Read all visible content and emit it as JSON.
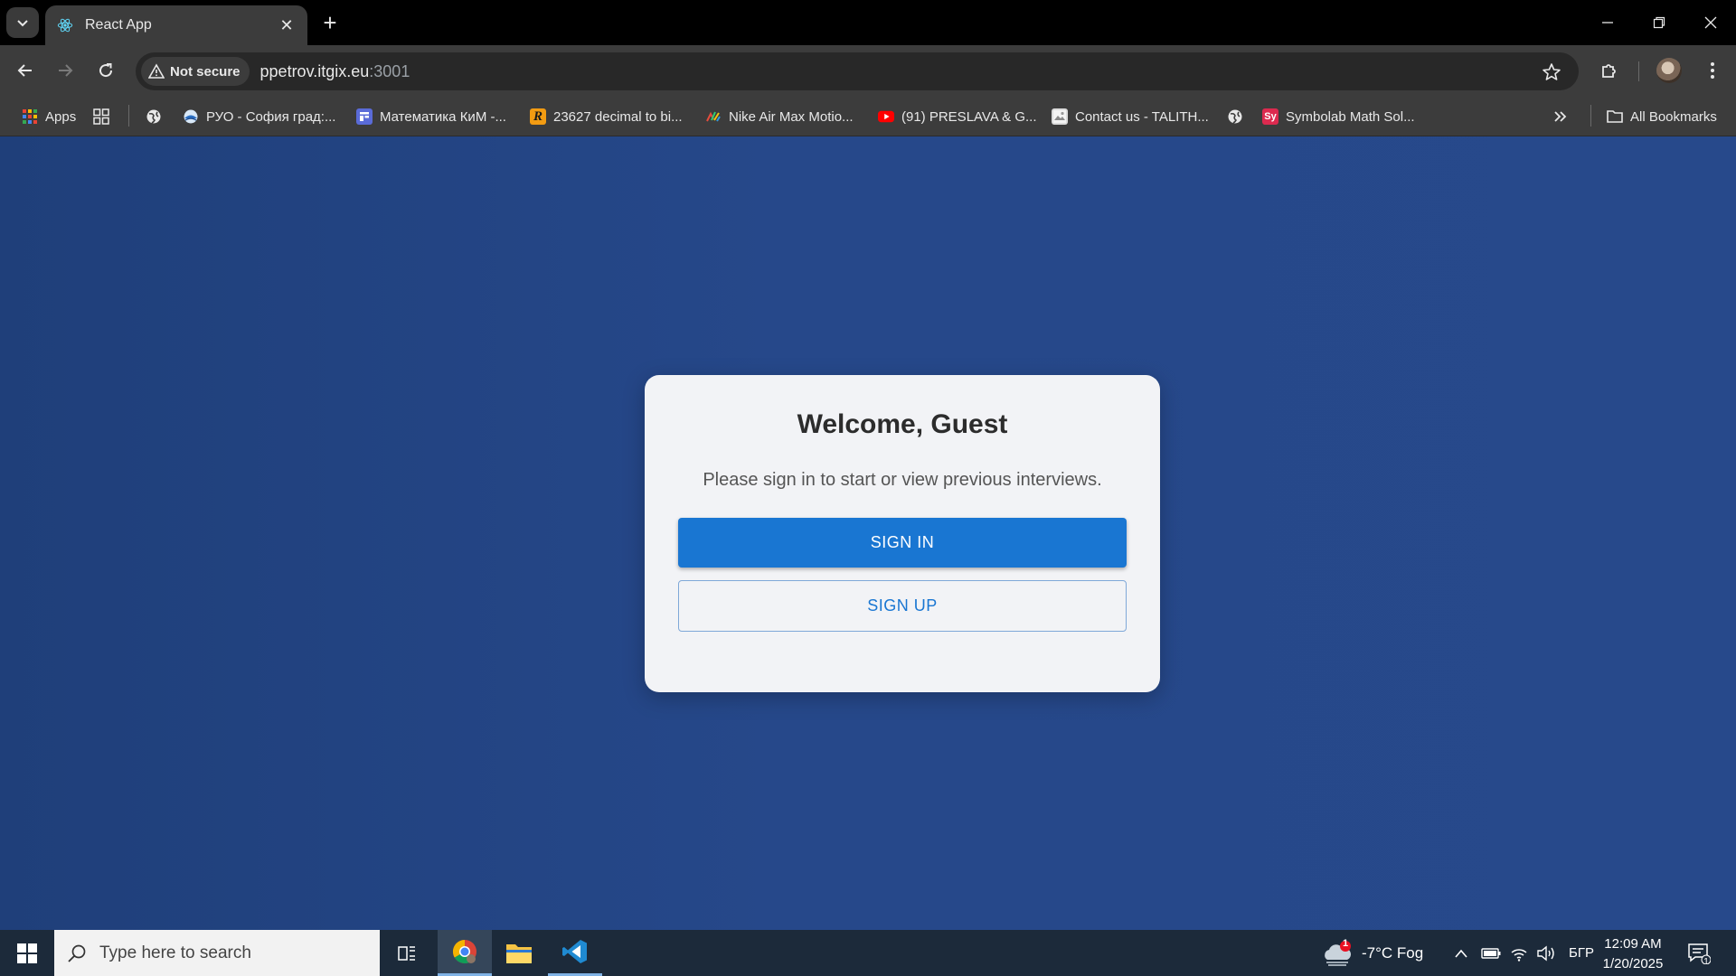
{
  "browser": {
    "tab": {
      "title": "React App"
    },
    "address": {
      "security_label": "Not secure",
      "host": "ppetrov.itgix.eu",
      "port": ":3001"
    },
    "bookmarks": [
      {
        "label": "Apps",
        "icon": "apps-grid-icon"
      },
      {
        "label": "",
        "icon": "tab-groups-icon"
      },
      {
        "label": "",
        "icon": "globe-icon"
      },
      {
        "label": "РУО - София град:...",
        "icon": "ruo-favicon-icon"
      },
      {
        "label": "Математика КиМ -...",
        "icon": "forms-favicon-icon"
      },
      {
        "label": "23627 decimal to bi...",
        "icon": "r-favicon-icon"
      },
      {
        "label": "Nike Air Max Motio...",
        "icon": "nike-favicon-icon"
      },
      {
        "label": "(91) PRESLAVA & G...",
        "icon": "youtube-icon"
      },
      {
        "label": "Contact us - TALITH...",
        "icon": "talith-favicon-icon"
      },
      {
        "label": "",
        "icon": "globe-icon"
      },
      {
        "label": "Symbolab Math Sol...",
        "icon": "symbolab-favicon-icon"
      }
    ],
    "all_bookmarks_label": "All Bookmarks",
    "symbolab_glyph": "Sy",
    "r_glyph": "R"
  },
  "card": {
    "title": "Welcome, Guest",
    "subtitle": "Please sign in to start or view previous interviews.",
    "sign_in_label": "SIGN IN",
    "sign_up_label": "SIGN UP"
  },
  "taskbar": {
    "search_placeholder": "Type here to search",
    "weather": "-7°C Fog",
    "weather_badge": "1",
    "language": "БГР",
    "time": "12:09 AM",
    "date": "1/20/2025",
    "notification_count": "1"
  },
  "colors": {
    "page_background": "#26488a",
    "primary": "#1976d2",
    "card_background": "#f2f3f6"
  }
}
